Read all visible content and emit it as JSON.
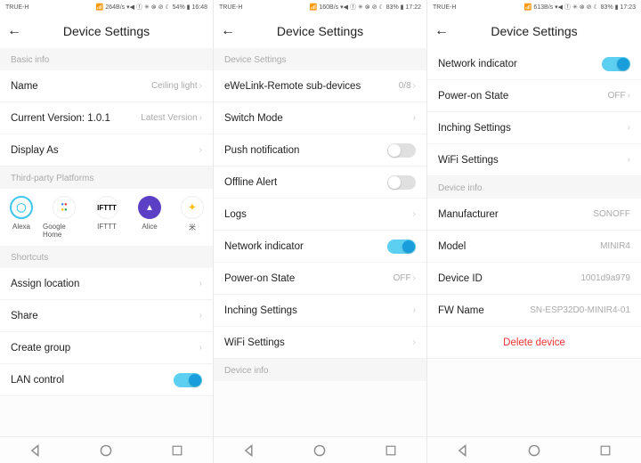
{
  "panels": [
    {
      "status": {
        "carrier": "TRUE-H",
        "rate": "264B/s",
        "battery": "54%",
        "time": "16:48"
      },
      "title": "Device Settings",
      "groups": [
        {
          "label": "Basic info",
          "rows": [
            {
              "label": "Name",
              "value": "Ceiling light",
              "chev": true
            },
            {
              "label": "Current Version:  1.0.1",
              "value": "Latest Version",
              "chev": true
            },
            {
              "label": "Display As",
              "value": "",
              "chev": true
            }
          ]
        },
        {
          "label": "Third-party Platforms",
          "platforms": [
            {
              "name": "Alexa"
            },
            {
              "name": "Google Home"
            },
            {
              "name": "IFTTT"
            },
            {
              "name": "Alice"
            },
            {
              "name": "米"
            }
          ]
        },
        {
          "label": "Shortcuts",
          "rows": [
            {
              "label": "Assign location",
              "value": "",
              "chev": true
            },
            {
              "label": "Share",
              "value": "",
              "chev": true
            },
            {
              "label": "Create group",
              "value": "",
              "chev": true
            },
            {
              "label": "LAN control",
              "toggle": "on"
            }
          ]
        }
      ]
    },
    {
      "status": {
        "carrier": "TRUE-H",
        "rate": "160B/s",
        "battery": "83%",
        "time": "17:22"
      },
      "title": "Device Settings",
      "groups": [
        {
          "label": "Device Settings",
          "rows": [
            {
              "label": "eWeLink-Remote sub-devices",
              "value": "0/8",
              "chev": true
            },
            {
              "label": "Switch Mode",
              "value": "",
              "chev": true
            },
            {
              "label": "Push notification",
              "toggle": "off"
            },
            {
              "label": "Offline Alert",
              "toggle": "off"
            },
            {
              "label": "Logs",
              "value": "",
              "chev": true
            },
            {
              "label": "Network indicator",
              "toggle": "on"
            },
            {
              "label": "Power-on State",
              "value": "OFF",
              "chev": true
            },
            {
              "label": "Inching Settings",
              "value": "",
              "chev": true
            },
            {
              "label": "WiFi Settings",
              "value": "",
              "chev": true
            }
          ]
        },
        {
          "label": "Device info",
          "rows": []
        }
      ]
    },
    {
      "status": {
        "carrier": "TRUE-H",
        "rate": "613B/s",
        "battery": "83%",
        "time": "17:23"
      },
      "title": "Device Settings",
      "groups": [
        {
          "label": "",
          "rows": [
            {
              "label": "Network indicator",
              "toggle": "on"
            },
            {
              "label": "Power-on State",
              "value": "OFF",
              "chev": true
            },
            {
              "label": "Inching Settings",
              "value": "",
              "chev": true
            },
            {
              "label": "WiFi Settings",
              "value": "",
              "chev": true
            }
          ]
        },
        {
          "label": "Device info",
          "rows": [
            {
              "label": "Manufacturer",
              "value": "SONOFF"
            },
            {
              "label": "Model",
              "value": "MINIR4"
            },
            {
              "label": "Device ID",
              "value": "1001d9a979"
            },
            {
              "label": "FW Name",
              "value": "SN-ESP32D0-MINIR4-01"
            }
          ]
        },
        {
          "label": "",
          "rows": [
            {
              "label": "Delete device",
              "danger": true
            }
          ]
        }
      ]
    }
  ],
  "status_icons": "▾◀ ⓕ ✳ ⊗ ⊘ ☾"
}
